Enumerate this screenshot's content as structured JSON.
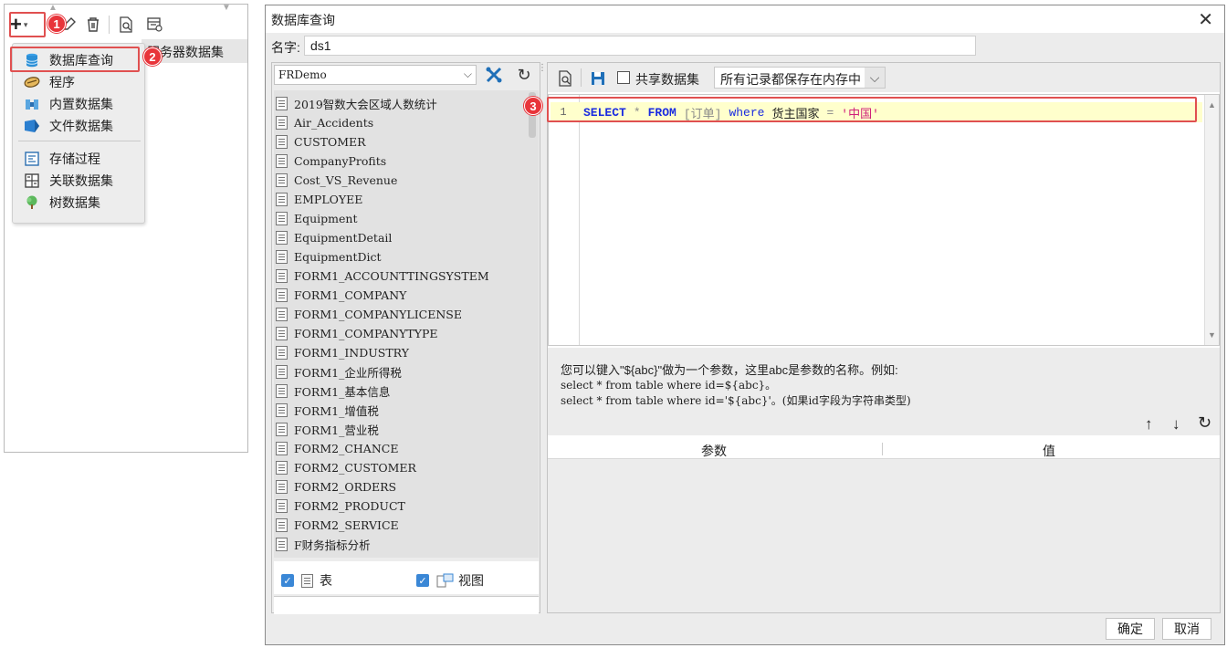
{
  "left_panel": {
    "toolbar": {
      "add_label": "+",
      "add_caret": "▾"
    },
    "list_header": "服务器数据集",
    "menu": [
      {
        "label": "数据库查询",
        "icon": "database-icon"
      },
      {
        "label": "程序",
        "icon": "program-icon"
      },
      {
        "label": "内置数据集",
        "icon": "builtin-dataset-icon"
      },
      {
        "label": "文件数据集",
        "icon": "file-dataset-icon"
      },
      {
        "label": "存储过程",
        "icon": "stored-procedure-icon"
      },
      {
        "label": "关联数据集",
        "icon": "related-dataset-icon"
      },
      {
        "label": "树数据集",
        "icon": "tree-dataset-icon"
      }
    ]
  },
  "badges": [
    "1",
    "2",
    "3"
  ],
  "dialog": {
    "title": "数据库查询",
    "close": "✕",
    "name_label": "名字:",
    "name_value": "ds1",
    "connection": "FRDemo",
    "tables": [
      "2019智数大会区域人数统计",
      "Air_Accidents",
      "CUSTOMER",
      "CompanyProfits",
      "Cost_VS_Revenue",
      "EMPLOYEE",
      "Equipment",
      "EquipmentDetail",
      "EquipmentDict",
      "FORM1_ACCOUNTTINGSYSTEM",
      "FORM1_COMPANY",
      "FORM1_COMPANYLICENSE",
      "FORM1_COMPANYTYPE",
      "FORM1_INDUSTRY",
      "FORM1_企业所得税",
      "FORM1_基本信息",
      "FORM1_增值税",
      "FORM1_营业税",
      "FORM2_CHANCE",
      "FORM2_CUSTOMER",
      "FORM2_ORDERS",
      "FORM2_PRODUCT",
      "FORM2_SERVICE",
      "F财务指标分析"
    ],
    "filter": {
      "table_label": "表",
      "view_label": "视图"
    },
    "share_label": "共享数据集",
    "cache_option": "所有记录都保存在内存中",
    "editor": {
      "line_number": "1",
      "sql": {
        "kw1": "SELECT",
        "star": "*",
        "kw2": "FROM",
        "table": "[订单]",
        "kw3": "where",
        "field": "货主国家",
        "op": "=",
        "value": "'中国'"
      }
    },
    "hint": {
      "line1": "您可以键入\"${abc}\"做为一个参数，这里abc是参数的名称。例如:",
      "line2": "select * from table where id=${abc}。",
      "line3": "select * from table where id='${abc}'。(如果id字段为字符串类型)"
    },
    "params": {
      "col_param": "参数",
      "col_value": "值"
    },
    "ok": "确定",
    "cancel": "取消"
  }
}
